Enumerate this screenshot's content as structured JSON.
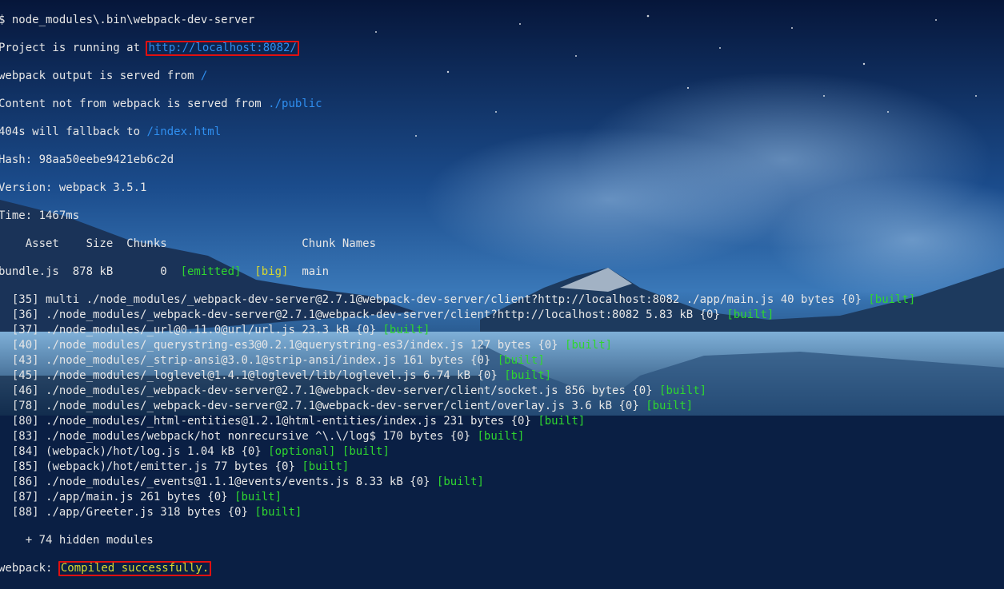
{
  "terminal": {
    "command": "$ node_modules\\.bin\\webpack-dev-server",
    "running_prefix": "Project is running at ",
    "running_url": "http://localhost:8082/",
    "output_prefix": "webpack output is served from ",
    "output_path": "/",
    "content_prefix": "Content not from webpack is served from ",
    "content_path": "./public",
    "fallback_prefix": "404s will fallback to ",
    "fallback_path": "/index.html",
    "hash": "Hash: 98aa50eebe9421eb6c2d",
    "version": "Version: webpack 3.5.1",
    "time": "Time: 1467ms",
    "asset_header": "    Asset    Size  Chunks                    Chunk Names",
    "bundle": {
      "name": "bundle.js  878 kB       0  ",
      "emitted": "[emitted]",
      "big": "[big]",
      "chunk": "main"
    },
    "modules": [
      {
        "id": "  [35] ",
        "path": "multi ./node_modules/_webpack-dev-server@2.7.1@webpack-dev-server/client?http://localhost:8082 ./app/main.js",
        "size": " 40 bytes {0} ",
        "tag": "[built]"
      },
      {
        "id": "  [36] ",
        "path": "./node_modules/_webpack-dev-server@2.7.1@webpack-dev-server/client?http://localhost:8082",
        "size": " 5.83 kB {0} ",
        "tag": "[built]"
      },
      {
        "id": "  [37] ",
        "path": "./node_modules/_url@0.11.0@url/url.js",
        "size": " 23.3 kB {0} ",
        "tag": "[built]"
      },
      {
        "id": "  [40] ",
        "path": "./node_modules/_querystring-es3@0.2.1@querystring-es3/index.js",
        "size": " 127 bytes {0} ",
        "tag": "[built]"
      },
      {
        "id": "  [43] ",
        "path": "./node_modules/_strip-ansi@3.0.1@strip-ansi/index.js",
        "size": " 161 bytes {0} ",
        "tag": "[built]"
      },
      {
        "id": "  [45] ",
        "path": "./node_modules/_loglevel@1.4.1@loglevel/lib/loglevel.js",
        "size": " 6.74 kB {0} ",
        "tag": "[built]"
      },
      {
        "id": "  [46] ",
        "path": "./node_modules/_webpack-dev-server@2.7.1@webpack-dev-server/client/socket.js",
        "size": " 856 bytes {0} ",
        "tag": "[built]"
      },
      {
        "id": "  [78] ",
        "path": "./node_modules/_webpack-dev-server@2.7.1@webpack-dev-server/client/overlay.js",
        "size": " 3.6 kB {0} ",
        "tag": "[built]"
      },
      {
        "id": "  [80] ",
        "path": "./node_modules/_html-entities@1.2.1@html-entities/index.js",
        "size": " 231 bytes {0} ",
        "tag": "[built]"
      },
      {
        "id": "  [83] ",
        "path": "./node_modules/webpack/hot nonrecursive ^\\.\\/log$",
        "size": " 170 bytes {0} ",
        "tag": "[built]"
      },
      {
        "id": "  [84] ",
        "path": "(webpack)/hot/log.js",
        "size": " 1.04 kB {0} ",
        "tag": "[optional] [built]"
      },
      {
        "id": "  [85] ",
        "path": "(webpack)/hot/emitter.js",
        "size": " 77 bytes {0} ",
        "tag": "[built]"
      },
      {
        "id": "  [86] ",
        "path": "./node_modules/_events@1.1.1@events/events.js",
        "size": " 8.33 kB {0} ",
        "tag": "[built]"
      },
      {
        "id": "  [87] ",
        "path": "./app/main.js",
        "size": " 261 bytes {0} ",
        "tag": "[built]"
      },
      {
        "id": "  [88] ",
        "path": "./app/Greeter.js",
        "size": " 318 bytes {0} ",
        "tag": "[built]"
      }
    ],
    "hidden": "    + 74 hidden modules",
    "webpack_prefix": "webpack: ",
    "status": "Compiled successfully."
  },
  "colors": {
    "url": "#2f8ff0",
    "built": "#2fd62f",
    "flag": "#d8d830",
    "highlight_box": "#e01010"
  }
}
